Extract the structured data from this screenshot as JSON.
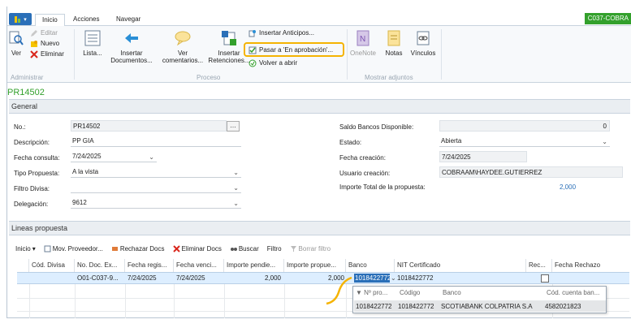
{
  "ribbon_tabs": [
    "Inicio",
    "Acciones",
    "Navegar"
  ],
  "context_badge": "C037-COBRA",
  "ribbon": {
    "ver": "Ver",
    "editar": "Editar",
    "nuevo": "Nuevo",
    "eliminar": "Eliminar",
    "lista": "Lista...",
    "insertar_docs": "Insertar\nDocumentos...",
    "ver_comentarios": "Ver\ncomentarios...",
    "insertar_retenciones": "Insertar\nRetenciones...",
    "insertar_anticipos": "Insertar Anticipos...",
    "pasar_aprobacion": "Pasar a  'En aprobación'...",
    "volver_abrir": "Volver a abrir",
    "onenote": "OneNote",
    "notas": "Notas",
    "vinculos": "Vínculos",
    "group_administrar": "Administrar",
    "group_proceso": "Proceso",
    "group_adjuntos": "Mostrar adjuntos"
  },
  "page_title": "PR14502",
  "general": {
    "header": "General",
    "no_label": "No.:",
    "no_value": "PR14502",
    "descripcion_label": "Descripción:",
    "descripcion_value": "PP GIA",
    "fecha_consulta_label": "Fecha consulta:",
    "fecha_consulta_value": "7/24/2025",
    "tipo_propuesta_label": "Tipo Propuesta:",
    "tipo_propuesta_value": "A la vista",
    "filtro_divisa_label": "Filtro Divisa:",
    "filtro_divisa_value": "",
    "delegacion_label": "Delegación:",
    "delegacion_value": "9612",
    "saldo_label": "Saldo Bancos Disponible:",
    "saldo_value": "0",
    "estado_label": "Estado:",
    "estado_value": "Abierta",
    "fecha_creacion_label": "Fecha creación:",
    "fecha_creacion_value": "7/24/2025",
    "usuario_label": "Usuario creación:",
    "usuario_value": "COBRAAM\\HAYDEE.GUTIERREZ",
    "importe_label": "Importe Total de la propuesta:",
    "importe_value": "2,000"
  },
  "lines": {
    "header": "Lineas propuesta",
    "toolbar": [
      "Inicio",
      "Mov. Proveedor...",
      "Rechazar Docs",
      "Eliminar Docs",
      "Buscar",
      "Filtro",
      "Borrar filtro"
    ],
    "columns": [
      "Cód. Divisa",
      "No. Doc. Ex...",
      "Fecha regis...",
      "Fecha venci...",
      "Importe pendie...",
      "Importe propue...",
      "Banco",
      "NIT Certificado",
      "Rec...",
      "Fecha Rechazo"
    ],
    "row": {
      "divisa": "",
      "doc": "O01-C037-9...",
      "fecha_reg": "7/24/2025",
      "fecha_venc": "7/24/2025",
      "importe_pend": "2,000",
      "importe_prop": "2,000",
      "banco": "1018422772",
      "nit": "1018422772"
    }
  },
  "popup": {
    "headers": [
      "Nº pro...",
      "Código",
      "Banco",
      "Cód. cuenta ban..."
    ],
    "row": [
      "1018422772",
      "1018422772",
      "SCOTIABANK COLPATRIA S.A",
      "4582021823"
    ]
  }
}
